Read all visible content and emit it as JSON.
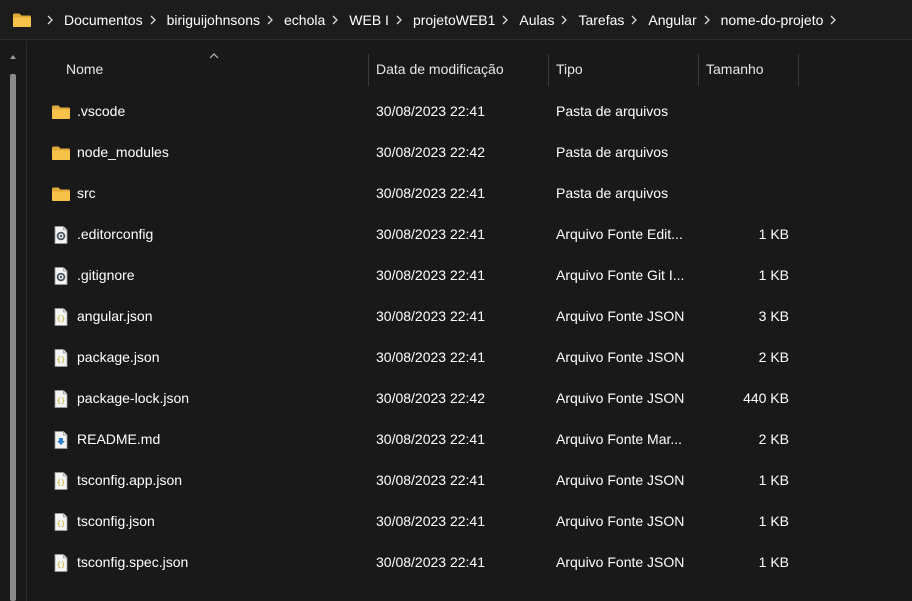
{
  "addressbar": {
    "crumbs": [
      "Documentos",
      "biriguijohnsons",
      "echola",
      "WEB I",
      "projetoWEB1",
      "Aulas",
      "Tarefas",
      "Angular",
      "nome-do-projeto"
    ],
    "icon": "folder-icon",
    "separator_icon": "chevron-right-icon"
  },
  "columns": {
    "name": "Nome",
    "date": "Data de modificação",
    "type": "Tipo",
    "size": "Tamanho"
  },
  "colors": {
    "background": "#191919",
    "folder": "#f7c24a",
    "text": "#ffffff"
  },
  "files": [
    {
      "name": ".vscode",
      "date": "30/08/2023 22:41",
      "type": "Pasta de arquivos",
      "size": "",
      "icon": "folder-icon"
    },
    {
      "name": "node_modules",
      "date": "30/08/2023 22:42",
      "type": "Pasta de arquivos",
      "size": "",
      "icon": "folder-icon"
    },
    {
      "name": "src",
      "date": "30/08/2023 22:41",
      "type": "Pasta de arquivos",
      "size": "",
      "icon": "folder-icon"
    },
    {
      "name": ".editorconfig",
      "date": "30/08/2023 22:41",
      "type": "Arquivo Fonte Edit...",
      "size": "1 KB",
      "icon": "config-file-icon"
    },
    {
      "name": ".gitignore",
      "date": "30/08/2023 22:41",
      "type": "Arquivo Fonte Git I...",
      "size": "1 KB",
      "icon": "config-file-icon"
    },
    {
      "name": "angular.json",
      "date": "30/08/2023 22:41",
      "type": "Arquivo Fonte JSON",
      "size": "3 KB",
      "icon": "json-file-icon"
    },
    {
      "name": "package.json",
      "date": "30/08/2023 22:41",
      "type": "Arquivo Fonte JSON",
      "size": "2 KB",
      "icon": "json-file-icon"
    },
    {
      "name": "package-lock.json",
      "date": "30/08/2023 22:42",
      "type": "Arquivo Fonte JSON",
      "size": "440 KB",
      "icon": "json-file-icon"
    },
    {
      "name": "README.md",
      "date": "30/08/2023 22:41",
      "type": "Arquivo Fonte Mar...",
      "size": "2 KB",
      "icon": "markdown-file-icon"
    },
    {
      "name": "tsconfig.app.json",
      "date": "30/08/2023 22:41",
      "type": "Arquivo Fonte JSON",
      "size": "1 KB",
      "icon": "json-file-icon"
    },
    {
      "name": "tsconfig.json",
      "date": "30/08/2023 22:41",
      "type": "Arquivo Fonte JSON",
      "size": "1 KB",
      "icon": "json-file-icon"
    },
    {
      "name": "tsconfig.spec.json",
      "date": "30/08/2023 22:41",
      "type": "Arquivo Fonte JSON",
      "size": "1 KB",
      "icon": "json-file-icon"
    }
  ]
}
